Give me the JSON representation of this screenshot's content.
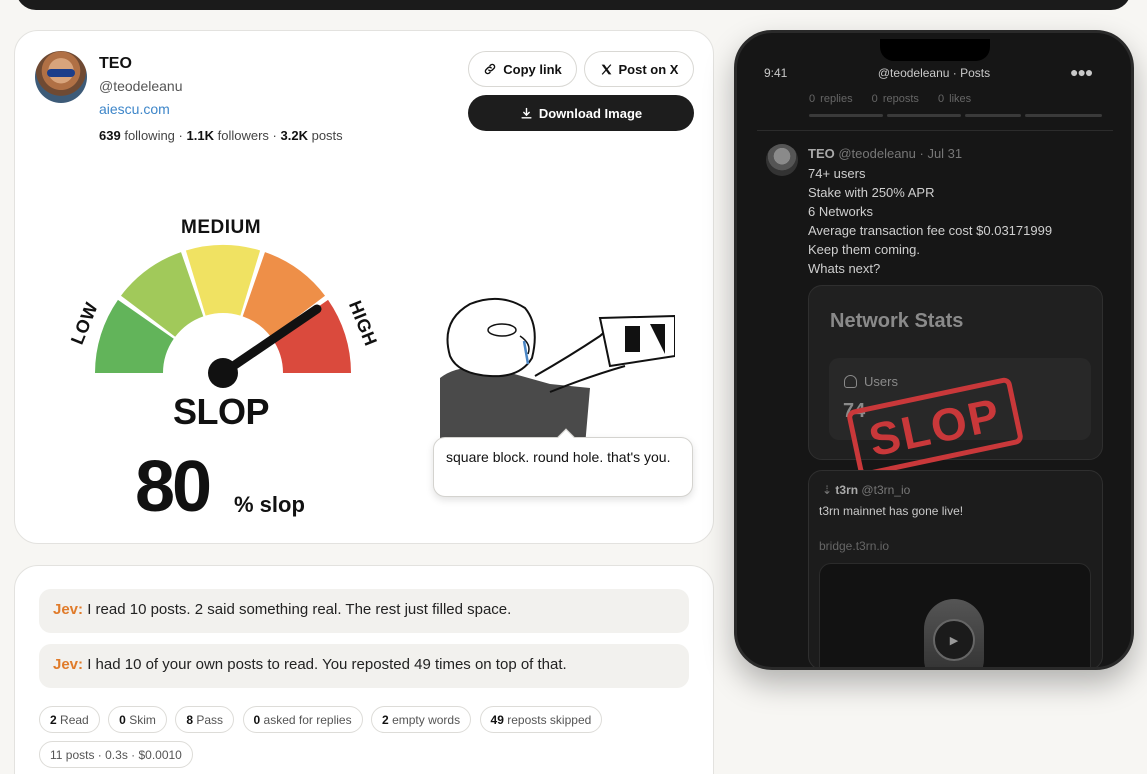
{
  "profile": {
    "name": "TEO",
    "handle": "@teodeleanu",
    "website": "aiescu.com",
    "following_count": "639",
    "following_label": "following",
    "followers_count": "1.1K",
    "followers_label": "followers",
    "posts_count": "3.2K",
    "posts_label": "posts",
    "separator": "·"
  },
  "actions": {
    "copy_link": "Copy link",
    "post_on_x": "Post on X",
    "download_image": "Download Image"
  },
  "gauge": {
    "low_label": "LOW",
    "medium_label": "MEDIUM",
    "high_label": "HIGH",
    "title": "SLOP",
    "score": "80",
    "score_unit": "% slop",
    "segment_colors": [
      "#62b45a",
      "#a1c95a",
      "#f0e262",
      "#ee8f48",
      "#da4a3d"
    ]
  },
  "meme": {
    "caption": "square block. round hole. that's you."
  },
  "jev": {
    "speaker": "Jev:",
    "lines": [
      "I read 10 posts. 2 said something real. The rest just filled space.",
      "I had 10 of your own posts to read. You reposted 49 times on top of that."
    ],
    "chips": [
      {
        "count": "2",
        "label": "Read"
      },
      {
        "count": "0",
        "label": "Skim"
      },
      {
        "count": "8",
        "label": "Pass"
      },
      {
        "count": "0",
        "label": "asked for replies"
      },
      {
        "count": "2",
        "label": "empty words"
      },
      {
        "count": "49",
        "label": "reposts skipped"
      }
    ],
    "footer": "11 posts · 0.3s · $0.0010"
  },
  "phone": {
    "time": "9:41",
    "header": "@teodeleanu · Posts",
    "counters": [
      "0 replies",
      "0 reposts",
      "0 likes"
    ],
    "post_author": "TEO",
    "post_meta": "@teodeleanu · Jul 31",
    "post_lines": [
      "74+ users",
      "Stake with 250% APR",
      "6 Networks",
      "Average transaction fee cost $0.03171999",
      "Keep them coming.",
      "Whats next?"
    ],
    "card_title": "Network Stats",
    "users_label": "Users",
    "users_value": "74",
    "stamp_text": "SLOP",
    "quote_author": "t3rn",
    "quote_handle": "@t3rn_io",
    "quote_text": "t3rn mainnet has gone live!",
    "quote_link": "bridge.t3rn.io"
  }
}
